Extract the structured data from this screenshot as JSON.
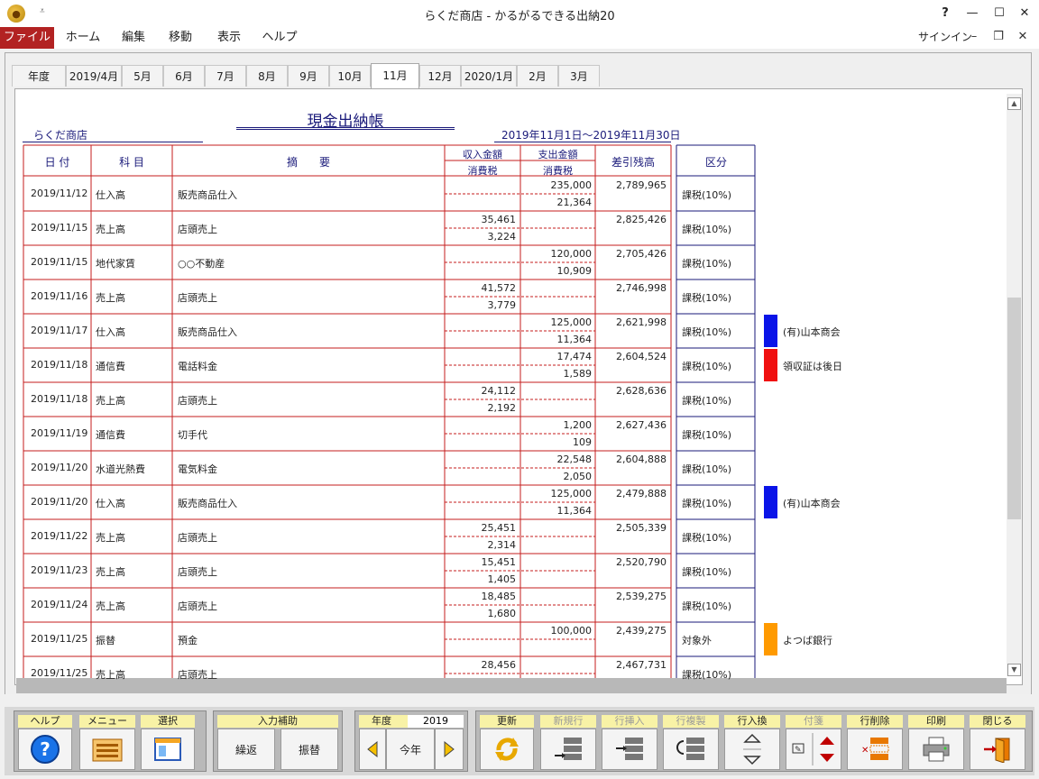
{
  "window": {
    "title": "らくだ商店 - かるがるできる出納20",
    "help": "?",
    "minimize": "—",
    "maximize": "☐",
    "close": "✕",
    "qat": "⩡"
  },
  "menu": {
    "items": [
      "ファイル",
      "ホーム",
      "編集",
      "移動",
      "表示",
      "ヘルプ"
    ],
    "signin": "サインイン",
    "r_min": "–",
    "r_restore": "❐",
    "r_close": "✕"
  },
  "tabs": [
    "年度",
    "2019/4月",
    "5月",
    "6月",
    "7月",
    "8月",
    "9月",
    "10月",
    "11月",
    "12月",
    "2020/1月",
    "2月",
    "3月"
  ],
  "active_tab": "11月",
  "report": {
    "title": "現金出納帳",
    "company": "らくだ商店",
    "period": "2019年11月1日～2019年11月30日",
    "headers": {
      "date": "日 付",
      "account": "科 目",
      "desc": "摘　　要",
      "income": "収入金額",
      "income_tax": "消費税",
      "expense": "支出金額",
      "expense_tax": "消費税",
      "balance": "差引残高",
      "category": "区分"
    }
  },
  "rows": [
    {
      "date": "2019/11/12",
      "account": "仕入高",
      "desc": "販売商品仕入",
      "income": "",
      "income_tax": "",
      "expense": "235,000",
      "expense_tax": "21,364",
      "balance": "2,789,965",
      "category": "課税(10%)",
      "note": "",
      "tag_color": ""
    },
    {
      "date": "2019/11/15",
      "account": "売上高",
      "desc": "店頭売上",
      "income": "35,461",
      "income_tax": "3,224",
      "expense": "",
      "expense_tax": "",
      "balance": "2,825,426",
      "category": "課税(10%)",
      "note": "",
      "tag_color": ""
    },
    {
      "date": "2019/11/15",
      "account": "地代家賃",
      "desc": "○○不動産",
      "income": "",
      "income_tax": "",
      "expense": "120,000",
      "expense_tax": "10,909",
      "balance": "2,705,426",
      "category": "課税(10%)",
      "note": "",
      "tag_color": ""
    },
    {
      "date": "2019/11/16",
      "account": "売上高",
      "desc": "店頭売上",
      "income": "41,572",
      "income_tax": "3,779",
      "expense": "",
      "expense_tax": "",
      "balance": "2,746,998",
      "category": "課税(10%)",
      "note": "",
      "tag_color": ""
    },
    {
      "date": "2019/11/17",
      "account": "仕入高",
      "desc": "販売商品仕入",
      "income": "",
      "income_tax": "",
      "expense": "125,000",
      "expense_tax": "11,364",
      "balance": "2,621,998",
      "category": "課税(10%)",
      "note": "(有)山本商会",
      "tag_color": "#0a14e8"
    },
    {
      "date": "2019/11/18",
      "account": "通信費",
      "desc": "電話料金",
      "income": "",
      "income_tax": "",
      "expense": "17,474",
      "expense_tax": "1,589",
      "balance": "2,604,524",
      "category": "課税(10%)",
      "note": "領収証は後日",
      "tag_color": "#f01010"
    },
    {
      "date": "2019/11/18",
      "account": "売上高",
      "desc": "店頭売上",
      "income": "24,112",
      "income_tax": "2,192",
      "expense": "",
      "expense_tax": "",
      "balance": "2,628,636",
      "category": "課税(10%)",
      "note": "",
      "tag_color": ""
    },
    {
      "date": "2019/11/19",
      "account": "通信費",
      "desc": "切手代",
      "income": "",
      "income_tax": "",
      "expense": "1,200",
      "expense_tax": "109",
      "balance": "2,627,436",
      "category": "課税(10%)",
      "note": "",
      "tag_color": ""
    },
    {
      "date": "2019/11/20",
      "account": "水道光熱費",
      "desc": "電気料金",
      "income": "",
      "income_tax": "",
      "expense": "22,548",
      "expense_tax": "2,050",
      "balance": "2,604,888",
      "category": "課税(10%)",
      "note": "",
      "tag_color": ""
    },
    {
      "date": "2019/11/20",
      "account": "仕入高",
      "desc": "販売商品仕入",
      "income": "",
      "income_tax": "",
      "expense": "125,000",
      "expense_tax": "11,364",
      "balance": "2,479,888",
      "category": "課税(10%)",
      "note": "(有)山本商会",
      "tag_color": "#0a14e8"
    },
    {
      "date": "2019/11/22",
      "account": "売上高",
      "desc": "店頭売上",
      "income": "25,451",
      "income_tax": "2,314",
      "expense": "",
      "expense_tax": "",
      "balance": "2,505,339",
      "category": "課税(10%)",
      "note": "",
      "tag_color": ""
    },
    {
      "date": "2019/11/23",
      "account": "売上高",
      "desc": "店頭売上",
      "income": "15,451",
      "income_tax": "1,405",
      "expense": "",
      "expense_tax": "",
      "balance": "2,520,790",
      "category": "課税(10%)",
      "note": "",
      "tag_color": ""
    },
    {
      "date": "2019/11/24",
      "account": "売上高",
      "desc": "店頭売上",
      "income": "18,485",
      "income_tax": "1,680",
      "expense": "",
      "expense_tax": "",
      "balance": "2,539,275",
      "category": "課税(10%)",
      "note": "",
      "tag_color": ""
    },
    {
      "date": "2019/11/25",
      "account": "振替",
      "desc": "預金",
      "income": "",
      "income_tax": "",
      "expense": "100,000",
      "expense_tax": "",
      "balance": "2,439,275",
      "category": "対象外",
      "note": "よつば銀行",
      "tag_color": "#ff9a00"
    },
    {
      "date": "2019/11/25",
      "account": "売上高",
      "desc": "店頭売上",
      "income": "28,456",
      "income_tax": "",
      "expense": "",
      "expense_tax": "",
      "balance": "2,467,731",
      "category": "課税(10%)",
      "note": "",
      "tag_color": ""
    }
  ],
  "toolbar": {
    "help": "ヘルプ",
    "menu": "メニュー",
    "select": "選択",
    "input_assist": "入力補助",
    "repeat": "繰返",
    "transfer": "振替",
    "year_label": "年度",
    "year_value": "2019",
    "this_year": "今年",
    "update": "更新",
    "new_row": "新規行",
    "insert_row": "行挿入",
    "copy_row": "行複製",
    "swap_row": "行入換",
    "sticky": "付箋",
    "delete_row": "行削除",
    "print": "印刷",
    "close": "閉じる"
  }
}
